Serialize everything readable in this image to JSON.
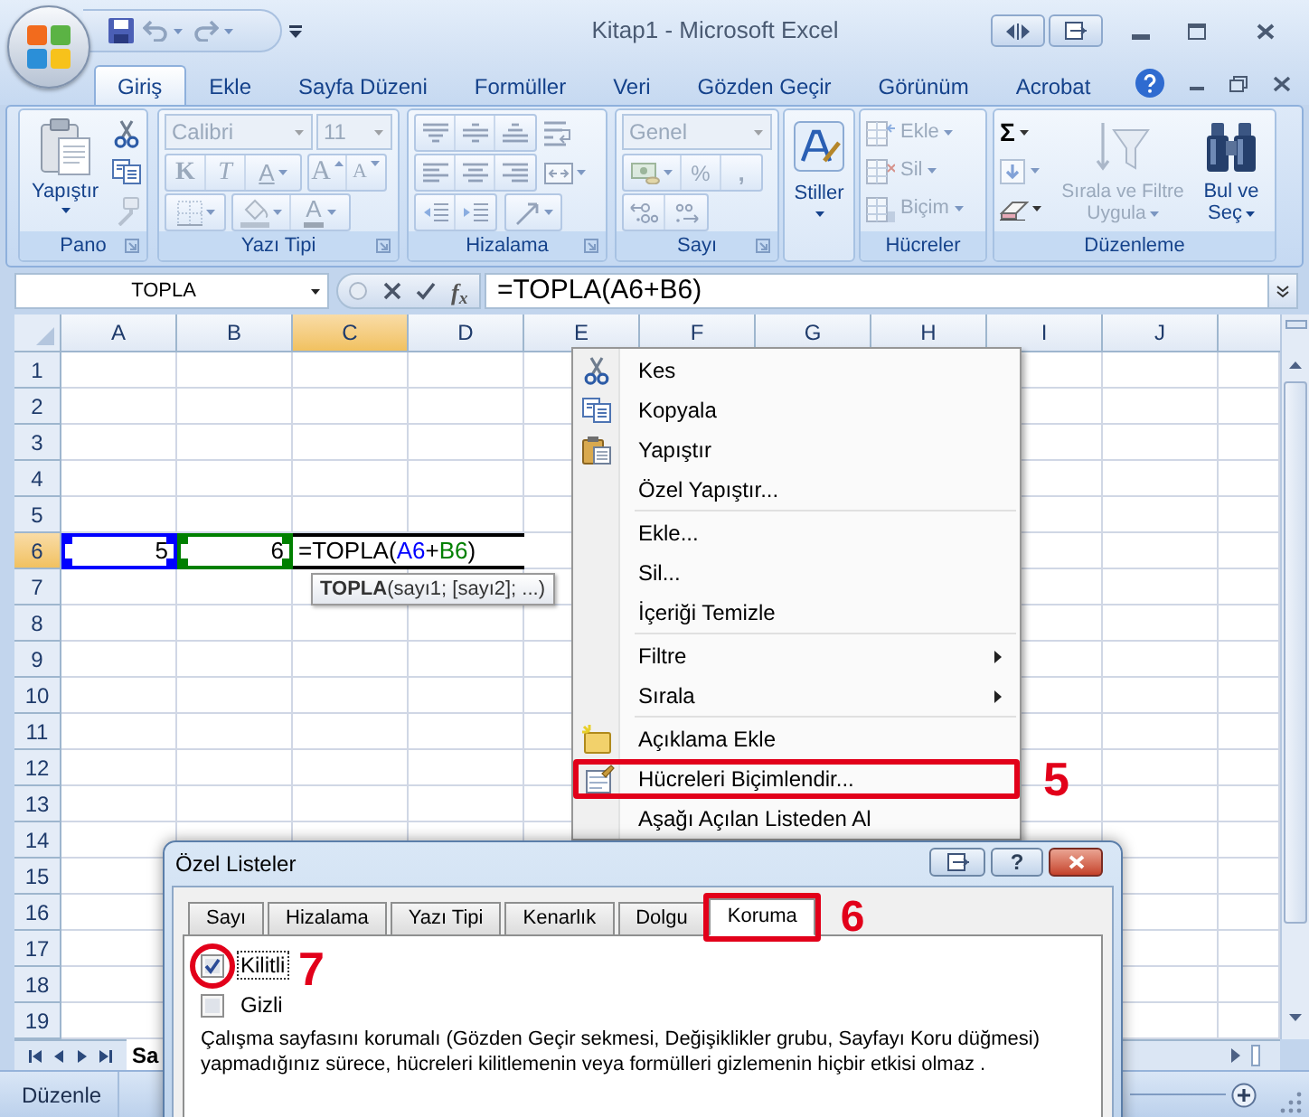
{
  "window": {
    "title": "Kitap1 - Microsoft Excel"
  },
  "ribbon_tabs": [
    {
      "label": "Giriş",
      "selected": true
    },
    {
      "label": "Ekle",
      "selected": false
    },
    {
      "label": "Sayfa Düzeni",
      "selected": false
    },
    {
      "label": "Formüller",
      "selected": false
    },
    {
      "label": "Veri",
      "selected": false
    },
    {
      "label": "Gözden Geçir",
      "selected": false
    },
    {
      "label": "Görünüm",
      "selected": false
    },
    {
      "label": "Acrobat",
      "selected": false
    }
  ],
  "ribbon": {
    "clipboard_group": {
      "label": "Pano",
      "paste_button": "Yapıştır"
    },
    "font_group": {
      "label": "Yazı Tipi",
      "disabled": true,
      "font_name": "Calibri",
      "font_size": "11",
      "bold_glyph": "K",
      "italic_glyph": "T",
      "underline_glyph": "A",
      "grow_glyph": "A",
      "shrink_glyph": "A",
      "font_color_glyph": "A"
    },
    "alignment_group": {
      "label": "Hizalama",
      "disabled": true
    },
    "number_group": {
      "label": "Sayı",
      "disabled": true,
      "number_format": "Genel",
      "percent_glyph": "%",
      "comma_glyph": ","
    },
    "styles_group": {
      "styles_button": "Stiller"
    },
    "cells_group": {
      "label": "Hücreler",
      "disabled": true,
      "buttons": [
        "Ekle",
        "Sil",
        "Biçim"
      ]
    },
    "editing_group": {
      "label": "Düzenleme",
      "sum_glyph": "Σ",
      "sort_filter_button": {
        "lines": [
          "Sırala ve Filtre",
          "Uygula"
        ],
        "disabled": true
      },
      "find_select_button": {
        "lines": [
          "Bul ve",
          "Seç"
        ],
        "disabled": false
      }
    }
  },
  "formula_bar": {
    "name_box": "TOPLA",
    "function_glyph": "f$_{x}$",
    "formula": "=TOPLA(A6+B6)"
  },
  "sheet": {
    "columns": [
      {
        "label": "A",
        "selected": false
      },
      {
        "label": "B",
        "selected": false
      },
      {
        "label": "C",
        "selected": true
      },
      {
        "label": "D",
        "selected": false
      },
      {
        "label": "E",
        "selected": false
      },
      {
        "label": "F",
        "selected": false
      },
      {
        "label": "G",
        "selected": false
      },
      {
        "label": "H",
        "selected": false
      },
      {
        "label": "I",
        "selected": false
      },
      {
        "label": "J",
        "selected": false
      }
    ],
    "rows": [
      {
        "label": "1",
        "selected": false
      },
      {
        "label": "2",
        "selected": false
      },
      {
        "label": "3",
        "selected": false
      },
      {
        "label": "4",
        "selected": false
      },
      {
        "label": "5",
        "selected": false
      },
      {
        "label": "6",
        "selected": true,
        "cells": [
          {
            "kind": "value",
            "value": "5",
            "color": "#0000ff"
          },
          {
            "kind": "value",
            "value": "6",
            "color": "#008000"
          },
          {
            "kind": "editing",
            "tokens": [
              {
                "text": "=TOPLA("
              },
              {
                "text": "A6",
                "color": "#0000ff"
              },
              {
                "text": "+"
              },
              {
                "text": "B6",
                "color": "#008000"
              },
              {
                "text": ")"
              }
            ]
          }
        ]
      },
      {
        "label": "7",
        "selected": false
      },
      {
        "label": "8",
        "selected": false
      },
      {
        "label": "9",
        "selected": false
      },
      {
        "label": "10",
        "selected": false
      },
      {
        "label": "11",
        "selected": false
      },
      {
        "label": "12",
        "selected": false
      },
      {
        "label": "13",
        "selected": false
      },
      {
        "label": "14",
        "selected": false
      },
      {
        "label": "15",
        "selected": false
      },
      {
        "label": "16",
        "selected": false
      },
      {
        "label": "17",
        "selected": false
      },
      {
        "label": "18",
        "selected": false
      },
      {
        "label": "19",
        "selected": false
      }
    ],
    "function_tooltip": "**TOPLA**(sayı1; [sayı2]; ...)"
  },
  "sheet_tabs": [
    {
      "label": "Sa",
      "selected": true
    }
  ],
  "status_bar": {
    "mode": "Düzenle"
  },
  "context_menu": {
    "items": [
      {
        "kind": "item",
        "label": "Kes",
        "submenu": false
      },
      {
        "kind": "item",
        "label": "Kopyala",
        "submenu": false
      },
      {
        "kind": "item",
        "label": "Yapıştır",
        "submenu": false
      },
      {
        "kind": "item",
        "label": "Özel Yapıştır...",
        "submenu": false
      },
      {
        "kind": "separator"
      },
      {
        "kind": "item",
        "label": "Ekle...",
        "submenu": false
      },
      {
        "kind": "item",
        "label": "Sil...",
        "submenu": false
      },
      {
        "kind": "item",
        "label": "İçeriği Temizle",
        "submenu": false
      },
      {
        "kind": "separator"
      },
      {
        "kind": "item",
        "label": "Filtre",
        "submenu": true
      },
      {
        "kind": "item",
        "label": "Sırala",
        "submenu": true
      },
      {
        "kind": "separator"
      },
      {
        "kind": "item",
        "label": "Açıklama Ekle",
        "submenu": false
      },
      {
        "kind": "item",
        "label": "Hücreleri Biçimlendir...",
        "submenu": false,
        "callout": "5"
      },
      {
        "kind": "item",
        "label": "Aşağı Açılan Listeden Al",
        "submenu": false
      }
    ]
  },
  "dialog": {
    "title": "Özel Listeler",
    "help_button": "?",
    "tabs": [
      {
        "label": "Sayı",
        "selected": false
      },
      {
        "label": "Hizalama",
        "selected": false
      },
      {
        "label": "Yazı Tipi",
        "selected": false
      },
      {
        "label": "Kenarlık",
        "selected": false
      },
      {
        "label": "Dolgu",
        "selected": false
      },
      {
        "label": "Koruma",
        "selected": true,
        "callout": "6"
      }
    ],
    "options": [
      {
        "label": "Kilitli",
        "checked": true,
        "focused": true,
        "callout": "7"
      },
      {
        "label": "Gizli",
        "checked": false,
        "focused": false
      }
    ],
    "note": "Çalışma sayfasını korumalı (Gözden Geçir sekmesi, Değişiklikler grubu, Sayfayı Koru düğmesi) yapmadığınız sürece, hücreleri kilitlemenin veya formülleri gizlemenin hiçbir etkisi olmaz ."
  }
}
